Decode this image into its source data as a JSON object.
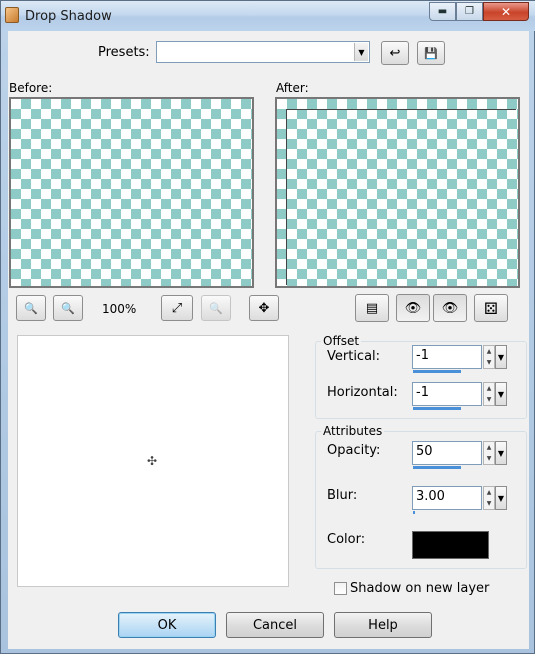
{
  "window": {
    "title": "Drop Shadow",
    "min": "▬",
    "max": "❐",
    "close": "✕"
  },
  "presets": {
    "label": "Presets:",
    "value": ""
  },
  "panes": {
    "before_label": "Before:",
    "after_label": "After:"
  },
  "zoom": {
    "level": "100%"
  },
  "offset": {
    "title": "Offset",
    "vertical": {
      "label": "Vertical:",
      "value": "-1"
    },
    "horizontal": {
      "label": "Horizontal:",
      "value": "-1"
    }
  },
  "attributes": {
    "title": "Attributes",
    "opacity": {
      "label": "Opacity:",
      "value": "50"
    },
    "blur": {
      "label": "Blur:",
      "value": "3.00"
    },
    "color": {
      "label": "Color:",
      "value": "#000000"
    }
  },
  "options": {
    "shadow_new_layer": {
      "label": "Shadow on new layer",
      "checked": false
    }
  },
  "buttons": {
    "ok": "OK",
    "cancel": "Cancel",
    "help": "Help"
  },
  "icons": {
    "combo_arrow": "▼",
    "reset": "↩",
    "save": "💾",
    "zoom_out": "🔍",
    "zoom_in": "🔍",
    "fit": "⤢",
    "zoom_disabled": "🔍",
    "move": "✥",
    "prev_toggle": "▤",
    "eye_cursor": "👁",
    "eye": "👁",
    "randomize": "⚄",
    "crosshair": "✣",
    "spin_up": "▲",
    "spin_down": "▼"
  },
  "colors": {
    "checker": "#8ecbc6",
    "accent_bar": "#4a90d9"
  }
}
